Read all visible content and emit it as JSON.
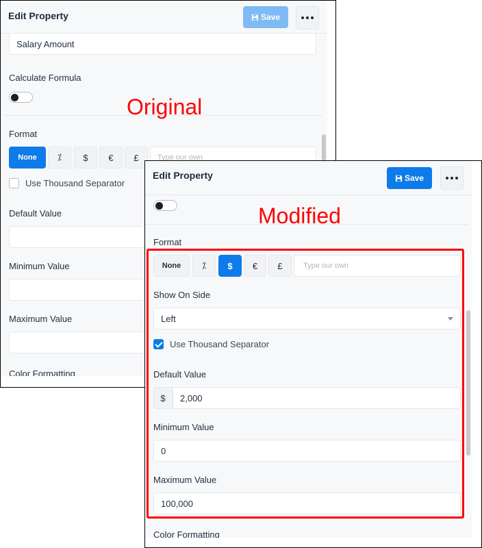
{
  "original": {
    "annotation": "Original",
    "header": {
      "title": "Edit Property",
      "save_label": "Save",
      "save_state": "disabled"
    },
    "name_field": {
      "value": "Salary Amount"
    },
    "calculate_formula": {
      "label": "Calculate Formula",
      "enabled": false
    },
    "format": {
      "label": "Format",
      "options": [
        "None",
        "%",
        "$",
        "€",
        "£"
      ],
      "selected": "None",
      "custom_placeholder": "Type our own"
    },
    "thousand_separator": {
      "label": "Use Thousand Separator",
      "checked": false
    },
    "default_value": {
      "label": "Default Value",
      "value": ""
    },
    "minimum_value": {
      "label": "Minimum Value",
      "value": ""
    },
    "maximum_value": {
      "label": "Maximum Value",
      "value": ""
    },
    "color_formatting": {
      "label": "Color Formatting"
    }
  },
  "modified": {
    "annotation": "Modified",
    "header": {
      "title": "Edit Property",
      "save_label": "Save",
      "save_state": "enabled"
    },
    "calculate_formula": {
      "enabled": false
    },
    "format": {
      "label": "Format",
      "options": [
        "None",
        "%",
        "$",
        "€",
        "£"
      ],
      "selected": "$",
      "custom_placeholder": "Type our own"
    },
    "show_on_side": {
      "label": "Show On Side",
      "value": "Left"
    },
    "thousand_separator": {
      "label": "Use Thousand Separator",
      "checked": true
    },
    "default_value": {
      "label": "Default Value",
      "prefix": "$",
      "value": "2,000"
    },
    "minimum_value": {
      "label": "Minimum Value",
      "value": "0"
    },
    "maximum_value": {
      "label": "Maximum Value",
      "value": "100,000"
    },
    "color_formatting": {
      "label": "Color Formatting"
    }
  },
  "colors": {
    "accent": "#0d7bea",
    "accent_disabled": "#7fbaf5",
    "annotation": "#ff0000",
    "panel_bg": "#f7f8fa"
  }
}
